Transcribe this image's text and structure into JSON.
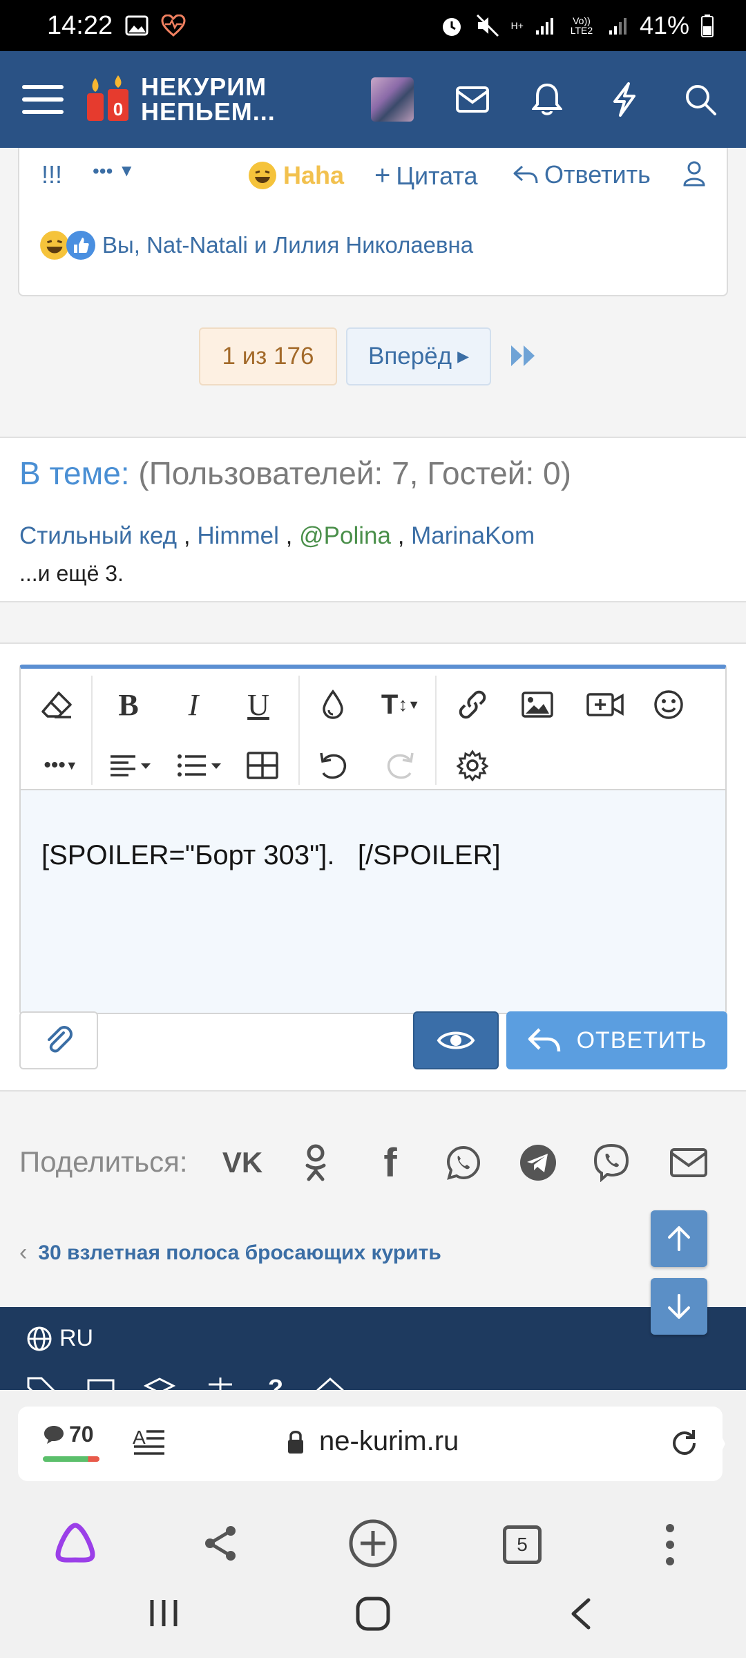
{
  "status_bar": {
    "time": "14:22",
    "network": "H+",
    "lte": "Vo)) LTE2",
    "battery": "41%"
  },
  "header": {
    "logo_line1": "НЕКУРИМ",
    "logo_line2": "НЕПЬЕМ..."
  },
  "post_actions": {
    "bang": "!!!",
    "more": "•••",
    "haha": "Haha",
    "quote": "Цитата",
    "reply": "Ответить",
    "reactions_text": "Вы, Nat-Natali и Лилия Николаевна"
  },
  "pagination": {
    "current": "1 из 176",
    "next": "Вперёд"
  },
  "topic": {
    "label": "В теме:",
    "counts": "(Пользователей: 7, Гостей: 0)",
    "users": [
      "Стильный кед",
      "Himmel",
      "@Polina",
      "MarinaKom"
    ],
    "sep": ",",
    "more": "...и ещё 3."
  },
  "editor": {
    "content": "[SPOILER=\"Борт 303\"].   [/SPOILER]",
    "reply_button": "ОТВЕТИТЬ"
  },
  "share": {
    "label": "Поделиться:"
  },
  "thread_link": "30 взлетная полоса бросающих курить",
  "footer": {
    "lang": "RU"
  },
  "browser": {
    "comments": "70",
    "url": "ne-kurim.ru",
    "tabs": "5"
  },
  "colors": {
    "header": "#2a5285",
    "accent": "#3b6ea5",
    "reply_btn": "#5b9ee0"
  }
}
